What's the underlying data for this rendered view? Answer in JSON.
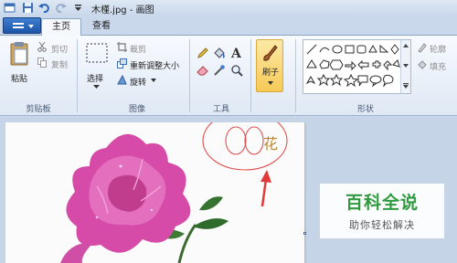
{
  "window": {
    "title": "木槿.jpg - 画图"
  },
  "quick_access": {
    "icons": [
      "paint-app-icon",
      "save-icon",
      "undo-icon",
      "redo-icon",
      "customize-caret-icon"
    ]
  },
  "tabs": [
    {
      "label": "主页",
      "active": true
    },
    {
      "label": "查看",
      "active": false
    }
  ],
  "ribbon": {
    "clipboard": {
      "paste_label": "粘贴",
      "cut_label": "剪切",
      "copy_label": "复制",
      "group_label": "剪贴板"
    },
    "image": {
      "select_label": "选择",
      "crop_label": "裁剪",
      "resize_label": "重新调整大小",
      "rotate_label": "旋转",
      "group_label": "图像"
    },
    "tools": {
      "group_label": "工具",
      "icons": [
        "pencil-icon",
        "fill-bucket-icon",
        "text-tool-icon",
        "eraser-icon",
        "color-picker-icon",
        "magnifier-icon"
      ]
    },
    "brushes": {
      "label": "刷子"
    },
    "shapes": {
      "group_label": "形状",
      "outline_label": "轮廓",
      "fill_label": "填充"
    }
  },
  "canvas": {
    "annotation_text": "花",
    "accent_colors": {
      "annotation": "#e05050",
      "flower": "#d93a9e",
      "leaf": "#2f6b2a"
    }
  },
  "watermark": {
    "title": "百科全说",
    "subtitle": "助你轻松解决",
    "color": "#2f9a3e"
  }
}
